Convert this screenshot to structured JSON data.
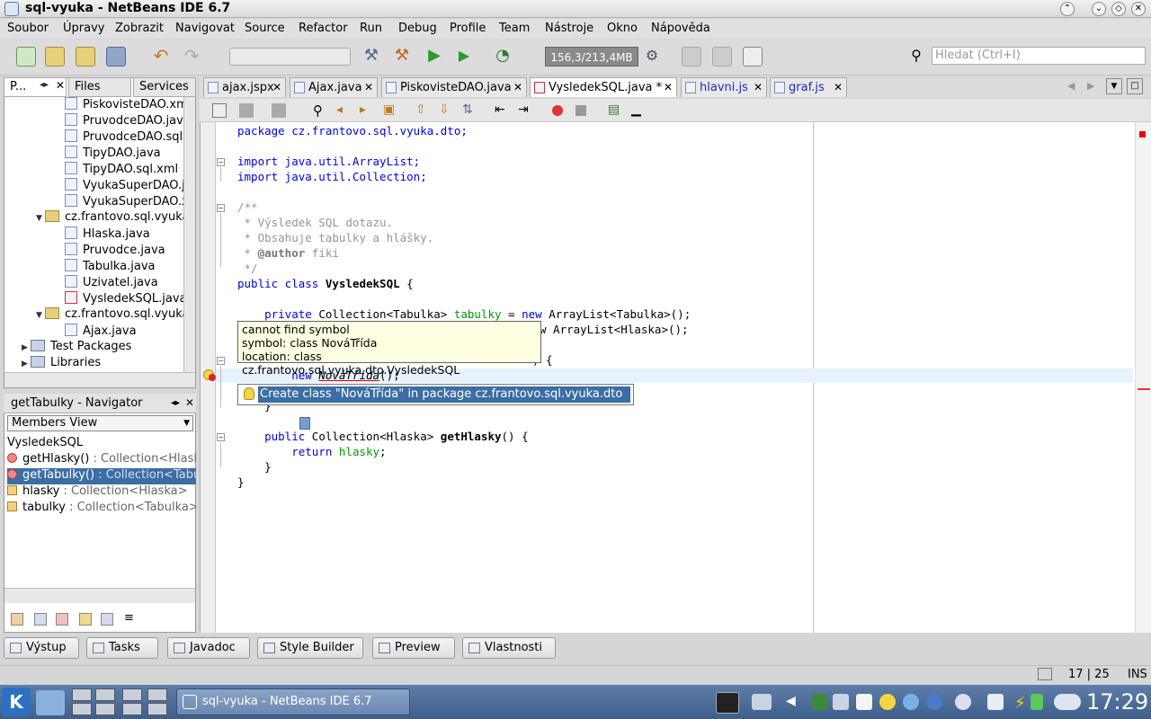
{
  "window": {
    "title": "sql-vyuka - NetBeans IDE 6.7"
  },
  "menu": [
    "Soubor",
    "Úpravy",
    "Zobrazit",
    "Navigovat",
    "Source",
    "Refactor",
    "Run",
    "Debug",
    "Profile",
    "Team",
    "Nástroje",
    "Okno",
    "Nápověda"
  ],
  "toolbar": {
    "memory": "156,3/213,4MB",
    "search_placeholder": "Hledat (Ctrl+I)"
  },
  "project_panel": {
    "tabs": [
      "P...",
      "Files",
      "Services"
    ],
    "tree": [
      {
        "label": "PiskovisteDAO.xml",
        "kind": "file"
      },
      {
        "label": "PruvodceDAO.java",
        "kind": "file"
      },
      {
        "label": "PruvodceDAO.sql.xml",
        "kind": "file"
      },
      {
        "label": "TipyDAO.java",
        "kind": "file"
      },
      {
        "label": "TipyDAO.sql.xml",
        "kind": "file"
      },
      {
        "label": "VyukaSuperDAO.java",
        "kind": "file"
      },
      {
        "label": "VyukaSuperDAO.xml",
        "kind": "file"
      },
      {
        "label": "cz.frantovo.sql.vyuka.dto",
        "kind": "package"
      },
      {
        "label": "Hlaska.java",
        "kind": "file"
      },
      {
        "label": "Pruvodce.java",
        "kind": "file"
      },
      {
        "label": "Tabulka.java",
        "kind": "file"
      },
      {
        "label": "Uzivatel.java",
        "kind": "file"
      },
      {
        "label": "VysledekSQL.java",
        "kind": "file-error"
      },
      {
        "label": "cz.frantovo.sql.vyuka.web",
        "kind": "package"
      },
      {
        "label": "Ajax.java",
        "kind": "file"
      },
      {
        "label": "Test Packages",
        "kind": "folder"
      },
      {
        "label": "Libraries",
        "kind": "folder"
      }
    ]
  },
  "navigator": {
    "title": "getTabulky - Navigator",
    "view": "Members View",
    "root": "VysledekSQL",
    "members": [
      {
        "name": "getHlasky()",
        "type": " : Collection<Hlaska>",
        "icon": "method"
      },
      {
        "name": "getTabulky()",
        "type": " : Collection<Tabulka>",
        "icon": "method"
      },
      {
        "name": "hlasky",
        "type": " : Collection<Hlaska>",
        "icon": "field"
      },
      {
        "name": "tabulky",
        "type": " : Collection<Tabulka>",
        "icon": "field"
      }
    ]
  },
  "editor_tabs": [
    {
      "label": "ajax.jspx"
    },
    {
      "label": "Ajax.java"
    },
    {
      "label": "PiskovisteDAO.java"
    },
    {
      "label": "VysledekSQL.java *"
    },
    {
      "label": "hlavni.js"
    },
    {
      "label": "graf.js"
    }
  ],
  "code": {
    "l1": "package cz.frantovo.sql.vyuka.dto;",
    "l3": "import java.util.ArrayList;",
    "l4": "import java.util.Collection;",
    "l6": "/**",
    "l7": " * Výsledek SQL dotazu.",
    "l8": " * Obsahuje tabulky a hlášky.",
    "l9a": " * ",
    "l9b": "@author",
    "l9c": " fiki",
    "l10": " */",
    "l11a": "public class ",
    "l11b": "VysledekSQL",
    "l11c": " {",
    "l13a": "    private ",
    "l13b": "Collection<Tabulka> ",
    "l13c": "tabulky",
    "l13d": " = ",
    "l13e": "new",
    "l13f": " ArrayList<Tabulka>();",
    "l14": "w ArrayList<Hlaska>();",
    "l15": ") {",
    "l16a": "        new ",
    "l16b": "NováTřída",
    "l16c": "();",
    "l17": "    }",
    "l19a": "    public ",
    "l19b": "Collection<Hlaska> ",
    "l19c": "getHlasky",
    "l19d": "() {",
    "l20a": "        return ",
    "l20b": "hlasky",
    "l20c": ";",
    "l21": "    }",
    "l22": "}"
  },
  "tooltip": {
    "line1": "cannot find symbol",
    "line2": "symbol: class NováTřída",
    "line3": "location: class cz.frantovo.sql.vyuka.dto.VysledekSQL"
  },
  "hint": "Create class \"NováTřída\" in package cz.frantovo.sql.vyuka.dto",
  "bottom_buttons": [
    "Výstup",
    "Tasks",
    "Javadoc",
    "Style Builder",
    "Preview",
    "Vlastnosti"
  ],
  "status": {
    "position": "17 | 25",
    "mode": "INS"
  },
  "taskbar": {
    "task": "sql-vyuka - NetBeans IDE 6.7",
    "clock": "17:29"
  }
}
